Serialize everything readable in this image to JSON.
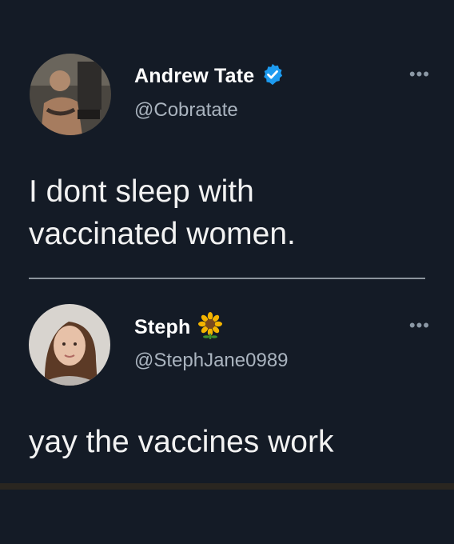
{
  "tweets": [
    {
      "display_name": "Andrew Tate",
      "handle": "@Cobratate",
      "verified": true,
      "text_lines": [
        "I dont sleep with",
        "vaccinated women."
      ],
      "more_label": "•••"
    },
    {
      "display_name": "Steph",
      "handle": "@StephJane0989",
      "name_emoji": "sunflower-icon",
      "text_lines": [
        "yay the vaccines work"
      ],
      "more_label": "•••"
    }
  ],
  "colors": {
    "background": "#141b26",
    "verified_badge": "#1d9bf0",
    "handle": "#aab4bf",
    "divider": "#8c949c"
  }
}
